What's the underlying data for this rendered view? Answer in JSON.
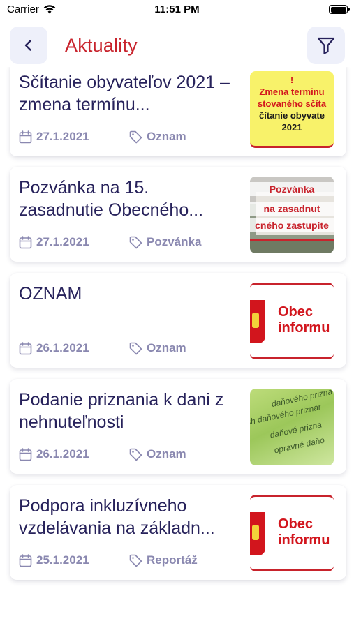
{
  "status_bar": {
    "carrier": "Carrier",
    "time": "11:51 PM"
  },
  "header": {
    "title": "Aktuality",
    "back_icon": "chevron-left-icon",
    "filter_icon": "filter-icon"
  },
  "colors": {
    "accent": "#c8232c",
    "title_text": "#27225b",
    "meta_text": "#8a88b0",
    "button_bg": "#eef0fa"
  },
  "articles": [
    {
      "title": "Sčítanie obyvateľov 2021 – zmena termínu...",
      "date": "27.1.2021",
      "category": "Oznam",
      "thumb": {
        "kind": "notice",
        "lines": [
          "!",
          "Zmena terminu",
          "stovaného sčíta",
          "čítanie obyvate",
          "2021"
        ]
      }
    },
    {
      "title": "Pozvánka na 15. zasadnutie Obecného...",
      "date": "27.1.2021",
      "category": "Pozvánka",
      "thumb": {
        "kind": "photo",
        "lines": [
          "Pozvánka",
          "na zasadnut",
          "cného zastupite"
        ]
      }
    },
    {
      "title": "OZNAM",
      "date": "26.1.2021",
      "category": "Oznam",
      "thumb": {
        "kind": "coat",
        "lines": [
          "Obec",
          "informu"
        ]
      }
    },
    {
      "title": "Podanie priznania k dani z nehnuteľnosti",
      "date": "26.1.2021",
      "category": "Oznam",
      "thumb": {
        "kind": "form",
        "lines": [
          "daňového prizna",
          "sh daňového priznar",
          "daňové prizna",
          "opravné daňo"
        ]
      }
    },
    {
      "title": "Podpora inkluzívneho vzdelávania na základn...",
      "date": "25.1.2021",
      "category": "Reportáž",
      "thumb": {
        "kind": "coat",
        "lines": [
          "Obec",
          "informu"
        ]
      }
    }
  ]
}
